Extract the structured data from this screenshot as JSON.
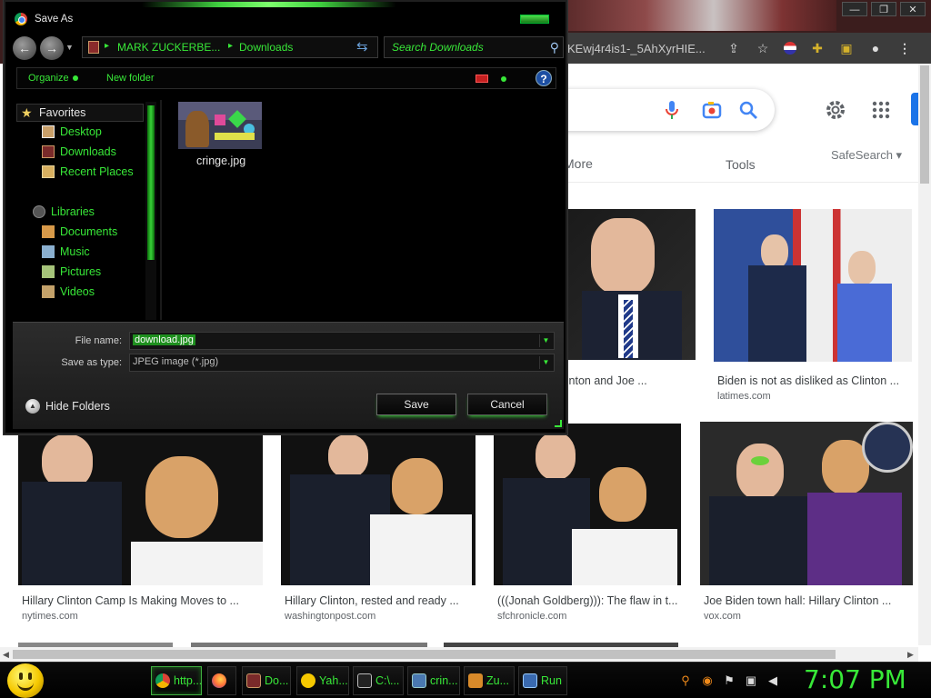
{
  "browser": {
    "address_fragment": "KEwj4r4is1-_5AhXyrHIE...",
    "filter_more": "More",
    "filter_tools": "Tools",
    "safesearch": "SafeSearch ▾",
    "results": [
      {
        "caption": "linton and Joe ...",
        "source": ""
      },
      {
        "caption": "Biden is not as disliked as Clinton ...",
        "source": "latimes.com"
      },
      {
        "caption": "Hillary Clinton Camp Is Making Moves to ...",
        "source": "nytimes.com"
      },
      {
        "caption": "Hillary Clinton, rested and ready ...",
        "source": "washingtonpost.com"
      },
      {
        "caption": "(((Jonah Goldberg))): The flaw in t...",
        "source": "sfchronicle.com"
      },
      {
        "caption": "Joe Biden town hall: Hillary Clinton ...",
        "source": "vox.com"
      }
    ]
  },
  "dialog": {
    "title": "Save As",
    "breadcrumb": [
      "MARK ZUCKERBE...",
      "Downloads"
    ],
    "search_placeholder": "Search Downloads",
    "toolbar": {
      "organize": "Organize",
      "new_folder": "New folder",
      "help": "?"
    },
    "nav": {
      "favorites": "Favorites",
      "favorite_items": [
        "Desktop",
        "Downloads",
        "Recent Places"
      ],
      "libraries": "Libraries",
      "library_items": [
        "Documents",
        "Music",
        "Pictures",
        "Videos"
      ]
    },
    "files": [
      {
        "name": "cringe.jpg"
      }
    ],
    "file_name_label": "File name:",
    "file_name_value": "download.jpg",
    "save_type_label": "Save as type:",
    "save_type_value": "JPEG image (*.jpg)",
    "hide_folders": "Hide Folders",
    "save_button": "Save",
    "cancel_button": "Cancel"
  },
  "taskbar": {
    "tasks": [
      "http...",
      "",
      "Do...",
      "Yah...",
      "C:\\...",
      "crin...",
      "Zu...",
      "Run"
    ],
    "clock": "7:07 PM"
  },
  "colors": {
    "accent_green": "#38e838",
    "dialog_bg": "#000000",
    "google_blue": "#1a73e8"
  }
}
